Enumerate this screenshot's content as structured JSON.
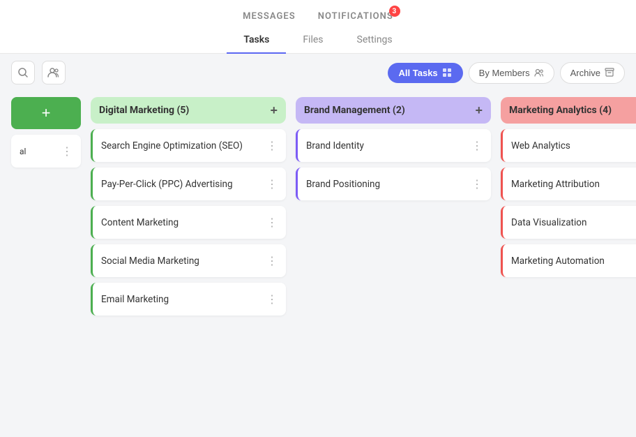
{
  "nav": {
    "messages_label": "MESSAGES",
    "notifications_label": "NOTIFICATIONS",
    "notification_count": "3"
  },
  "tabs": [
    {
      "label": "Tasks",
      "active": true
    },
    {
      "label": "Files",
      "active": false
    },
    {
      "label": "Settings",
      "active": false
    }
  ],
  "toolbar": {
    "search_icon": "🔍",
    "user_icon": "👥",
    "all_tasks_label": "All Tasks",
    "by_members_label": "By Members",
    "archive_label": "Archive"
  },
  "columns": [
    {
      "id": "partial",
      "partial": true,
      "label": "al",
      "color": "green",
      "cards": [
        {
          "label": ""
        }
      ]
    },
    {
      "id": "digital-marketing",
      "label": "Digital Marketing (5)",
      "color": "green",
      "cards": [
        {
          "label": "Search Engine Optimization (SEO)"
        },
        {
          "label": "Pay-Per-Click (PPC) Advertising"
        },
        {
          "label": "Content Marketing"
        },
        {
          "label": "Social Media Marketing"
        },
        {
          "label": "Email Marketing"
        }
      ]
    },
    {
      "id": "brand-management",
      "label": "Brand Management (2)",
      "color": "purple",
      "cards": [
        {
          "label": "Brand Identity"
        },
        {
          "label": "Brand Positioning"
        }
      ]
    },
    {
      "id": "marketing-analytics",
      "label": "Marketing Analytics (4)",
      "color": "red",
      "cards": [
        {
          "label": "Web Analytics"
        },
        {
          "label": "Marketing Attribution"
        },
        {
          "label": "Data Visualization"
        },
        {
          "label": "Marketing Automation"
        }
      ]
    }
  ]
}
